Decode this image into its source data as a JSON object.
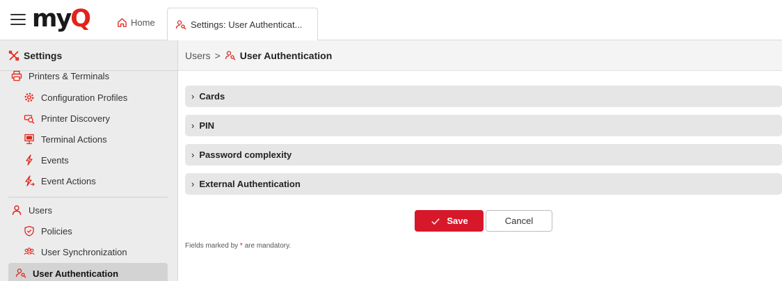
{
  "topbar": {
    "logo_main": "my",
    "logo_accent": "Q",
    "home_label": "Home",
    "tab_label": "Settings: User Authenticat..."
  },
  "sidebar": {
    "title": "Settings",
    "items": [
      {
        "label": "Printers & Terminals",
        "icon": "printer-icon"
      },
      {
        "label": "Configuration Profiles",
        "icon": "gear-icon"
      },
      {
        "label": "Printer Discovery",
        "icon": "printer-search-icon"
      },
      {
        "label": "Terminal Actions",
        "icon": "terminal-icon"
      },
      {
        "label": "Events",
        "icon": "lightning-icon"
      },
      {
        "label": "Event Actions",
        "icon": "lightning-arrow-icon"
      },
      {
        "label": "Users",
        "icon": "user-icon"
      },
      {
        "label": "Policies",
        "icon": "shield-icon"
      },
      {
        "label": "User Synchronization",
        "icon": "users-sync-icon"
      },
      {
        "label": "User Authentication",
        "icon": "user-key-icon",
        "active": true
      }
    ]
  },
  "breadcrumb": {
    "parent": "Users",
    "separator": ">",
    "current": "User Authentication"
  },
  "sections": [
    {
      "label": "Cards"
    },
    {
      "label": "PIN"
    },
    {
      "label": "Password complexity"
    },
    {
      "label": "External Authentication"
    }
  ],
  "actions": {
    "save_label": "Save",
    "cancel_label": "Cancel"
  },
  "footer": {
    "mandatory_prefix": "Fields marked by",
    "mandatory_star": "*",
    "mandatory_suffix": "are mandatory."
  },
  "colors": {
    "accent": "#d7182a",
    "icon_red": "#e2231a"
  }
}
